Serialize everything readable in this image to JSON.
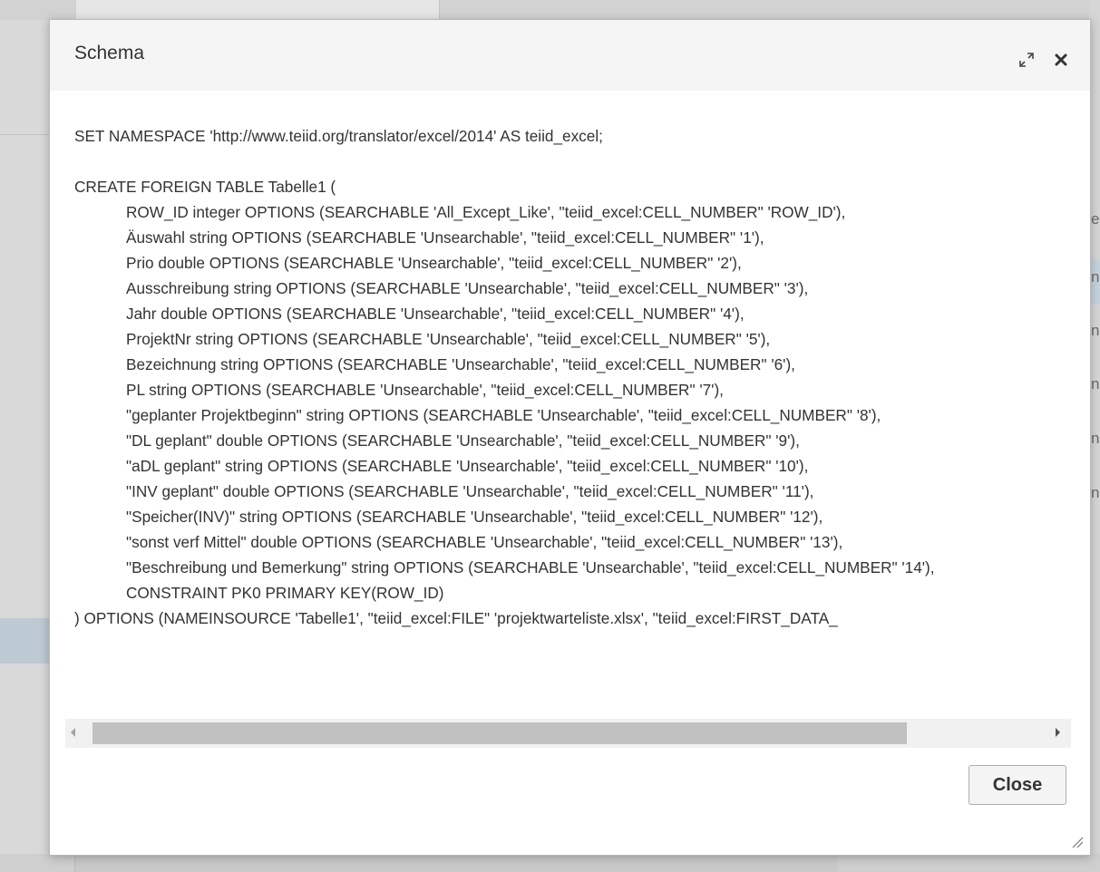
{
  "modal": {
    "title": "Schema",
    "close_button_label": "Close",
    "code_lines": [
      {
        "text": "SET NAMESPACE 'http://www.teiid.org/translator/excel/2014' AS teiid_excel;",
        "indent": false
      },
      {
        "text": "",
        "indent": false
      },
      {
        "text": "CREATE FOREIGN TABLE Tabelle1 (",
        "indent": false
      },
      {
        "text": "ROW_ID integer OPTIONS (SEARCHABLE 'All_Except_Like', \"teiid_excel:CELL_NUMBER\" 'ROW_ID'),",
        "indent": true
      },
      {
        "text": "Äuswahl string OPTIONS (SEARCHABLE 'Unsearchable', \"teiid_excel:CELL_NUMBER\" '1'),",
        "indent": true
      },
      {
        "text": "Prio double OPTIONS (SEARCHABLE 'Unsearchable', \"teiid_excel:CELL_NUMBER\" '2'),",
        "indent": true
      },
      {
        "text": "Ausschreibung string OPTIONS (SEARCHABLE 'Unsearchable', \"teiid_excel:CELL_NUMBER\" '3'),",
        "indent": true
      },
      {
        "text": "Jahr double OPTIONS (SEARCHABLE 'Unsearchable', \"teiid_excel:CELL_NUMBER\" '4'),",
        "indent": true
      },
      {
        "text": "ProjektNr string OPTIONS (SEARCHABLE 'Unsearchable', \"teiid_excel:CELL_NUMBER\" '5'),",
        "indent": true
      },
      {
        "text": "Bezeichnung string OPTIONS (SEARCHABLE 'Unsearchable', \"teiid_excel:CELL_NUMBER\" '6'),",
        "indent": true
      },
      {
        "text": "PL string OPTIONS (SEARCHABLE 'Unsearchable', \"teiid_excel:CELL_NUMBER\" '7'),",
        "indent": true
      },
      {
        "text": "\"geplanter Projektbeginn\" string OPTIONS (SEARCHABLE 'Unsearchable', \"teiid_excel:CELL_NUMBER\" '8'),",
        "indent": true
      },
      {
        "text": "\"DL geplant\" double OPTIONS (SEARCHABLE 'Unsearchable', \"teiid_excel:CELL_NUMBER\" '9'),",
        "indent": true
      },
      {
        "text": "\"aDL geplant\" string OPTIONS (SEARCHABLE 'Unsearchable', \"teiid_excel:CELL_NUMBER\" '10'),",
        "indent": true
      },
      {
        "text": "\"INV geplant\" double OPTIONS (SEARCHABLE 'Unsearchable', \"teiid_excel:CELL_NUMBER\" '11'),",
        "indent": true
      },
      {
        "text": "\"Speicher(INV)\" string OPTIONS (SEARCHABLE 'Unsearchable', \"teiid_excel:CELL_NUMBER\" '12'),",
        "indent": true
      },
      {
        "text": "\"sonst verf Mittel\" double OPTIONS (SEARCHABLE 'Unsearchable', \"teiid_excel:CELL_NUMBER\" '13'),",
        "indent": true
      },
      {
        "text": "\"Beschreibung und Bemerkung\" string OPTIONS (SEARCHABLE 'Unsearchable', \"teiid_excel:CELL_NUMBER\" '14'),",
        "indent": true
      },
      {
        "text": "CONSTRAINT PK0 PRIMARY KEY(ROW_ID)",
        "indent": true
      },
      {
        "text": ") OPTIONS (NAMEINSOURCE 'Tabelle1', \"teiid_excel:FILE\" 'projektwarteliste.xlsx', \"teiid_excel:FIRST_DATA_",
        "indent": false
      }
    ]
  },
  "icons": {
    "expand": "expand-icon",
    "close": "close-icon",
    "resize": "resize-grip-icon",
    "scroll_left": "arrow-left-icon",
    "scroll_right": "arrow-right-icon"
  },
  "background": {
    "right_edge_chars": [
      "e",
      "n",
      "n",
      "n",
      "n",
      "n"
    ]
  },
  "colors": {
    "header_bg": "#f5f5f5",
    "text": "#333333",
    "scroll_thumb": "#c1c1c1"
  }
}
